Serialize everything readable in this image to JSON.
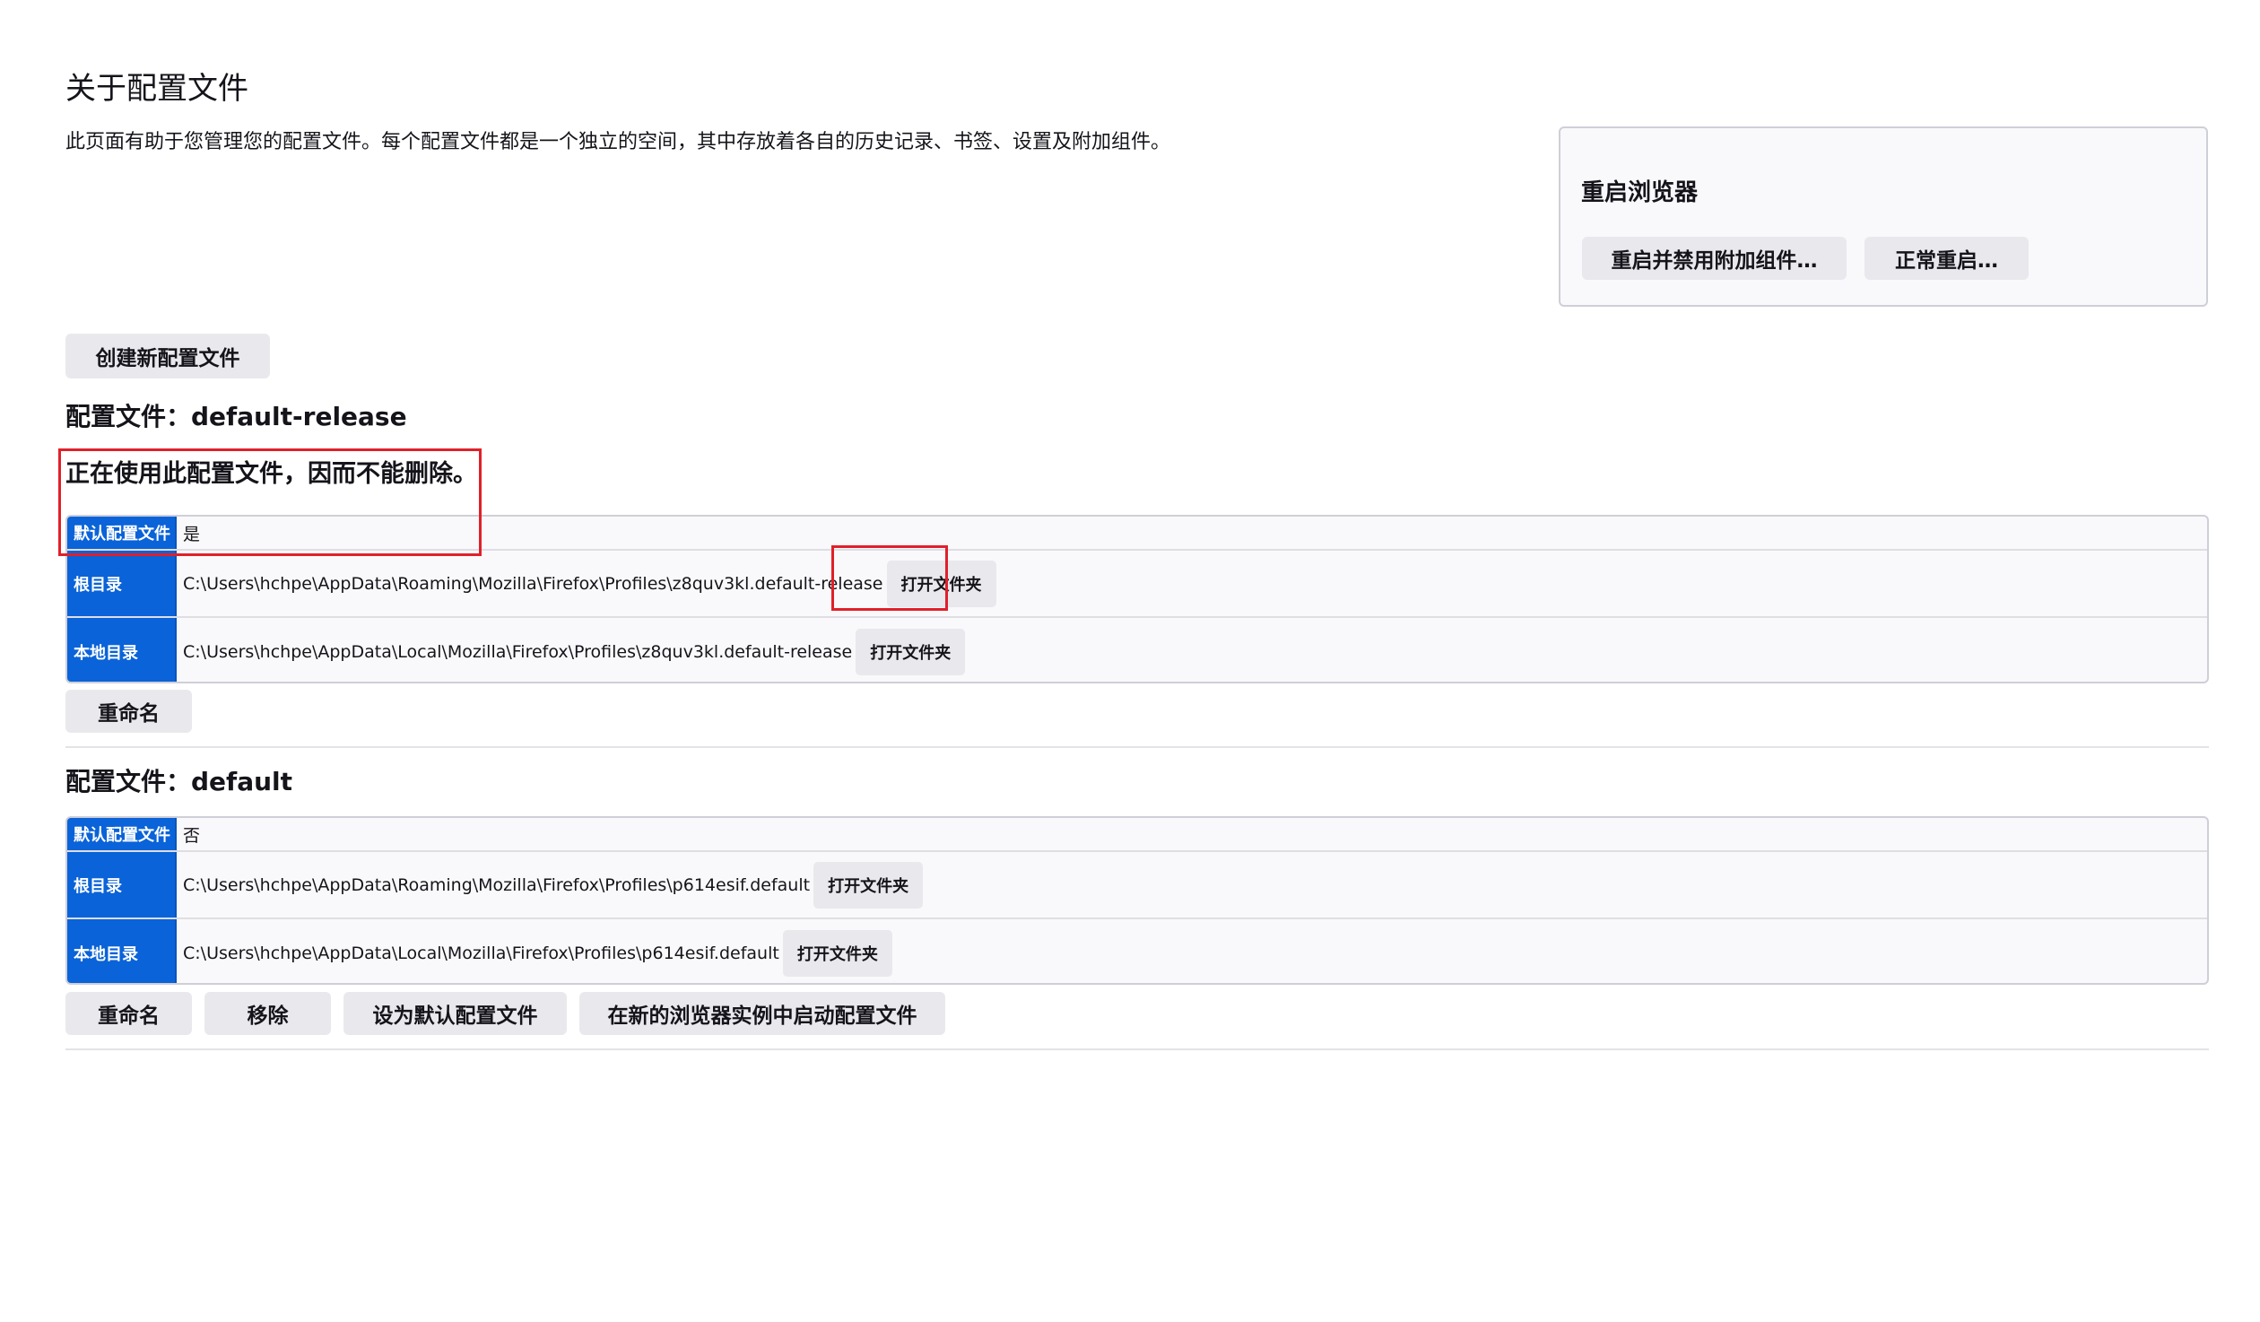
{
  "page": {
    "title": "关于配置文件",
    "intro": "此页面有助于您管理您的配置文件。每个配置文件都是一个独立的空间，其中存放着各自的历史记录、书签、设置及附加组件。"
  },
  "restart": {
    "title": "重启浏览器",
    "restart_disable_addons": "重启并禁用附加组件…",
    "restart_normal": "正常重启…"
  },
  "create_profile_label": "创建新配置文件",
  "labels": {
    "default_profile": "默认配置文件",
    "root_dir": "根目录",
    "local_dir": "本地目录",
    "open_folder": "打开文件夹"
  },
  "profiles": [
    {
      "title": "配置文件：default-release",
      "in_use_message": "正在使用此配置文件，因而不能删除。",
      "is_default": "是",
      "root_dir": "C:\\Users\\hchpe\\AppData\\Roaming\\Mozilla\\Firefox\\Profiles\\z8quv3kl.default-release",
      "local_dir": "C:\\Users\\hchpe\\AppData\\Local\\Mozilla\\Firefox\\Profiles\\z8quv3kl.default-release",
      "actions": {
        "rename": "重命名"
      }
    },
    {
      "title": "配置文件：default",
      "is_default": "否",
      "root_dir": "C:\\Users\\hchpe\\AppData\\Roaming\\Mozilla\\Firefox\\Profiles\\p614esif.default",
      "local_dir": "C:\\Users\\hchpe\\AppData\\Local\\Mozilla\\Firefox\\Profiles\\p614esif.default",
      "actions": {
        "rename": "重命名",
        "remove": "移除",
        "set_default": "设为默认配置文件",
        "launch": "在新的浏览器实例中启动配置文件"
      }
    }
  ],
  "colors": {
    "header_cell": "#0a63d8",
    "highlight": "#e0202a",
    "button_bg": "#e9e9ed"
  }
}
